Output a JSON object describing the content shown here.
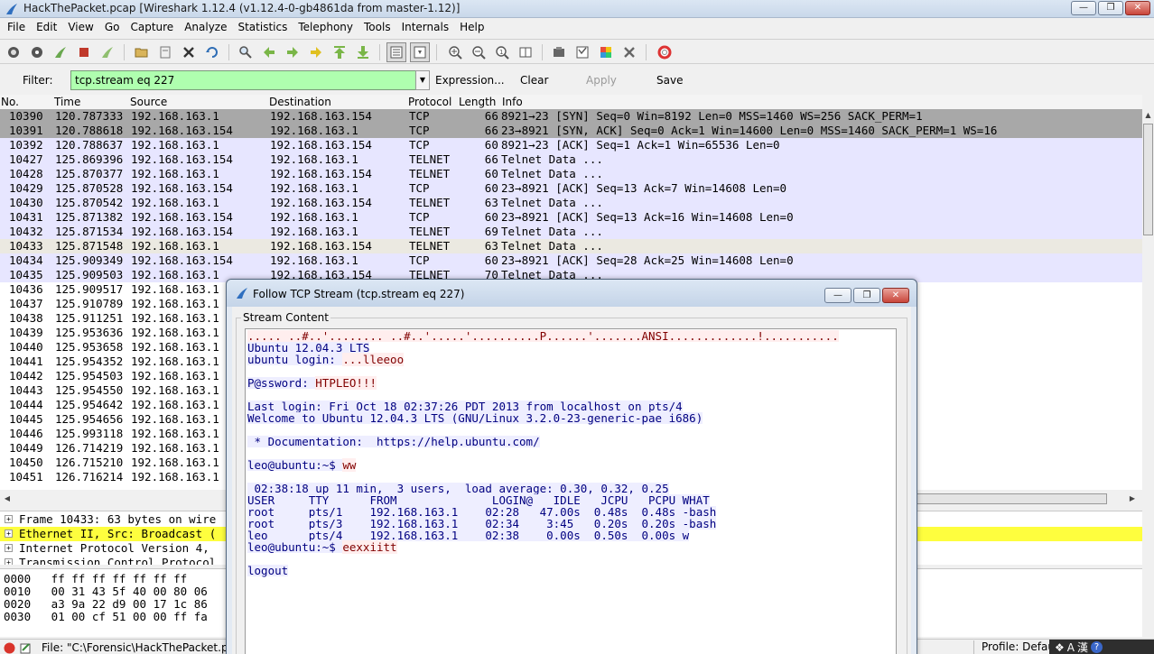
{
  "window": {
    "title": "HackThePacket.pcap   [Wireshark 1.12.4  (v1.12.4-0-gb4861da from master-1.12)]"
  },
  "menu": [
    "File",
    "Edit",
    "View",
    "Go",
    "Capture",
    "Analyze",
    "Statistics",
    "Telephony",
    "Tools",
    "Internals",
    "Help"
  ],
  "filter": {
    "label": "Filter:",
    "value": "tcp.stream eq 227",
    "expression": "Expression...",
    "clear": "Clear",
    "apply": "Apply",
    "save": "Save"
  },
  "packet_list": {
    "headers": [
      "No.",
      "Time",
      "Source",
      "Destination",
      "Protocol",
      "Length",
      "Info"
    ],
    "rows": [
      {
        "no": "10390",
        "time": "120.787333",
        "src": "192.168.163.1",
        "dst": "192.168.163.154",
        "proto": "TCP",
        "len": "66",
        "info": "8921→23 [SYN] Seq=0 Win=8192 Len=0 MSS=1460 WS=256 SACK_PERM=1"
      },
      {
        "no": "10391",
        "time": "120.788618",
        "src": "192.168.163.154",
        "dst": "192.168.163.1",
        "proto": "TCP",
        "len": "66",
        "info": "23→8921 [SYN, ACK] Seq=0 Ack=1 Win=14600 Len=0 MSS=1460 SACK_PERM=1 WS=16"
      },
      {
        "no": "10392",
        "time": "120.788637",
        "src": "192.168.163.1",
        "dst": "192.168.163.154",
        "proto": "TCP",
        "len": "60",
        "info": "8921→23 [ACK] Seq=1 Ack=1 Win=65536 Len=0"
      },
      {
        "no": "10427",
        "time": "125.869396",
        "src": "192.168.163.154",
        "dst": "192.168.163.1",
        "proto": "TELNET",
        "len": "66",
        "info": "Telnet Data ..."
      },
      {
        "no": "10428",
        "time": "125.870377",
        "src": "192.168.163.1",
        "dst": "192.168.163.154",
        "proto": "TELNET",
        "len": "60",
        "info": "Telnet Data ..."
      },
      {
        "no": "10429",
        "time": "125.870528",
        "src": "192.168.163.154",
        "dst": "192.168.163.1",
        "proto": "TCP",
        "len": "60",
        "info": "23→8921 [ACK] Seq=13 Ack=7 Win=14608 Len=0"
      },
      {
        "no": "10430",
        "time": "125.870542",
        "src": "192.168.163.1",
        "dst": "192.168.163.154",
        "proto": "TELNET",
        "len": "63",
        "info": "Telnet Data ..."
      },
      {
        "no": "10431",
        "time": "125.871382",
        "src": "192.168.163.154",
        "dst": "192.168.163.1",
        "proto": "TCP",
        "len": "60",
        "info": "23→8921 [ACK] Seq=13 Ack=16 Win=14608 Len=0"
      },
      {
        "no": "10432",
        "time": "125.871534",
        "src": "192.168.163.154",
        "dst": "192.168.163.1",
        "proto": "TELNET",
        "len": "69",
        "info": "Telnet Data ..."
      },
      {
        "no": "10433",
        "time": "125.871548",
        "src": "192.168.163.1",
        "dst": "192.168.163.154",
        "proto": "TELNET",
        "len": "63",
        "info": "Telnet Data ..."
      },
      {
        "no": "10434",
        "time": "125.909349",
        "src": "192.168.163.154",
        "dst": "192.168.163.1",
        "proto": "TCP",
        "len": "60",
        "info": "23→8921 [ACK] Seq=28 Ack=25 Win=14608 Len=0"
      },
      {
        "no": "10435",
        "time": "125.909503",
        "src": "192.168.163.1",
        "dst": "192.168.163.154",
        "proto": "TELNET",
        "len": "70",
        "info": "Telnet Data ..."
      },
      {
        "no": "10436",
        "time": "125.909517",
        "src": "192.168.163.1",
        "dst": "",
        "proto": "",
        "len": "",
        "info": ""
      },
      {
        "no": "10437",
        "time": "125.910789",
        "src": "192.168.163.1",
        "dst": "",
        "proto": "",
        "len": "",
        "info": ""
      },
      {
        "no": "10438",
        "time": "125.911251",
        "src": "192.168.163.1",
        "dst": "",
        "proto": "",
        "len": "",
        "info": ""
      },
      {
        "no": "10439",
        "time": "125.953636",
        "src": "192.168.163.1",
        "dst": "",
        "proto": "",
        "len": "",
        "info": ""
      },
      {
        "no": "10440",
        "time": "125.953658",
        "src": "192.168.163.1",
        "dst": "",
        "proto": "",
        "len": "",
        "info": ""
      },
      {
        "no": "10441",
        "time": "125.954352",
        "src": "192.168.163.1",
        "dst": "",
        "proto": "",
        "len": "",
        "info": ""
      },
      {
        "no": "10442",
        "time": "125.954503",
        "src": "192.168.163.1",
        "dst": "",
        "proto": "",
        "len": "",
        "info": ""
      },
      {
        "no": "10443",
        "time": "125.954550",
        "src": "192.168.163.1",
        "dst": "",
        "proto": "",
        "len": "",
        "info": ""
      },
      {
        "no": "10444",
        "time": "125.954642",
        "src": "192.168.163.1",
        "dst": "",
        "proto": "",
        "len": "",
        "info": ""
      },
      {
        "no": "10445",
        "time": "125.954656",
        "src": "192.168.163.1",
        "dst": "",
        "proto": "",
        "len": "",
        "info": ""
      },
      {
        "no": "10446",
        "time": "125.993118",
        "src": "192.168.163.1",
        "dst": "",
        "proto": "",
        "len": "",
        "info": ""
      },
      {
        "no": "10449",
        "time": "126.714219",
        "src": "192.168.163.1",
        "dst": "",
        "proto": "",
        "len": "",
        "info": ""
      },
      {
        "no": "10450",
        "time": "126.715210",
        "src": "192.168.163.1",
        "dst": "",
        "proto": "",
        "len": "",
        "info": ""
      },
      {
        "no": "10451",
        "time": "126.716214",
        "src": "192.168.163.1",
        "dst": "",
        "proto": "",
        "len": "",
        "info": ""
      }
    ]
  },
  "details": [
    "Frame 10433: 63 bytes on wire",
    "Ethernet II, Src: Broadcast (",
    "Internet Protocol Version 4,",
    "Transmission Control Protocol"
  ],
  "bytes": [
    "0000   ff ff ff ff ff ff ff",
    "0010   00 31 43 5f 40 00 80 06",
    "0020   a3 9a 22 d9 00 17 1c 86",
    "0030   01 00 cf 51 00 00 ff fa"
  ],
  "status": {
    "file": "File: \"C:\\Forensic\\HackThePacket.pca",
    "profile": "Profile: Defaul"
  },
  "dialog": {
    "title": "Follow TCP Stream (tcp.stream eq 227)",
    "group_label": "Stream Content",
    "lines": [
      {
        "text": "..... ..#..'........ ..#..'.....'..........P......'.......ANSI.............!...........",
        "dir": "cli"
      },
      {
        "text": "Ubuntu 12.04.3 LTS",
        "dir": "srv"
      },
      {
        "text": "ubuntu login: ",
        "dir": "srv",
        "extra": "...lleeoo"
      },
      {
        "text": "",
        "dir": "srv"
      },
      {
        "text": "P@ssword: ",
        "dir": "srv",
        "extra": "HTPLEO!!!"
      },
      {
        "text": "",
        "dir": "srv"
      },
      {
        "text": "Last login: Fri Oct 18 02:37:26 PDT 2013 from localhost on pts/4",
        "dir": "srv"
      },
      {
        "text": "Welcome to Ubuntu 12.04.3 LTS (GNU/Linux 3.2.0-23-generic-pae i686)",
        "dir": "srv"
      },
      {
        "text": "",
        "dir": "srv"
      },
      {
        "text": " * Documentation:  https://help.ubuntu.com/",
        "dir": "srv"
      },
      {
        "text": "",
        "dir": "srv"
      },
      {
        "text": "leo@ubuntu:~$ ",
        "dir": "srv",
        "extra": "ww"
      },
      {
        "text": "",
        "dir": "srv"
      },
      {
        "text": " 02:38:18 up 11 min,  3 users,  load average: 0.30, 0.32, 0.25",
        "dir": "srv"
      },
      {
        "text": "USER     TTY      FROM              LOGIN@   IDLE   JCPU   PCPU WHAT",
        "dir": "srv"
      },
      {
        "text": "root     pts/1    192.168.163.1    02:28   47.00s  0.48s  0.48s -bash",
        "dir": "srv"
      },
      {
        "text": "root     pts/3    192.168.163.1    02:34    3:45   0.20s  0.20s -bash",
        "dir": "srv"
      },
      {
        "text": "leo      pts/4    192.168.163.1    02:38    0.00s  0.50s  0.00s w",
        "dir": "srv"
      },
      {
        "text": "leo@ubuntu:~$ ",
        "dir": "srv",
        "extra": "eexxiitt"
      },
      {
        "text": "",
        "dir": "srv"
      },
      {
        "text": "logout",
        "dir": "srv"
      }
    ]
  },
  "colors": {
    "filter_ok": "#afffaf",
    "selected_row": "#a8a8a8",
    "tcp_row": "#e7e6ff",
    "server_text": "#000080",
    "client_text": "#800000",
    "detail_highlight": "#fefe3e"
  }
}
